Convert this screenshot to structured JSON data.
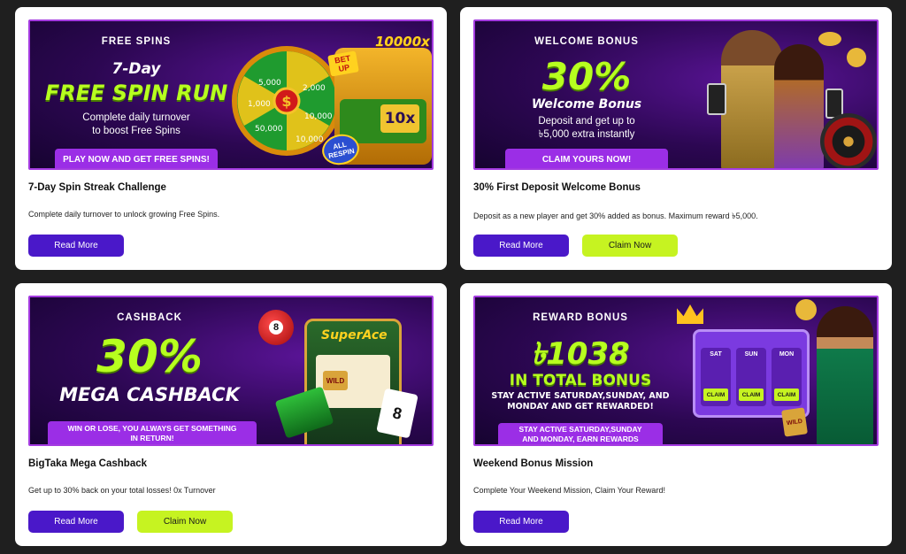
{
  "cards": [
    {
      "banner": {
        "kicker": "FREE SPINS",
        "line1": "7-Day",
        "headline": "FREE SPIN RUN",
        "sub1": "Complete daily turnover",
        "sub2": "to boost Free Spins",
        "cta": "PLAY NOW AND GET FREE SPINS!",
        "wheel_labels": [
          "5,000",
          "1,000",
          "50,000",
          "10,000",
          "2,000",
          "10,000"
        ],
        "multiplier": "10000x",
        "bet_up": "BET UP",
        "ten_x": "10x",
        "all_respin": "ALL RESPIN"
      },
      "title": "7-Day Spin Streak Challenge",
      "description": "Complete daily turnover to unlock growing Free Spins.",
      "read_more": "Read More"
    },
    {
      "banner": {
        "kicker": "WELCOME BONUS",
        "headline": "30%",
        "line2": "Welcome Bonus",
        "sub1": "Deposit and get up to",
        "sub2": "৳5,000 extra instantly",
        "cta": "CLAIM YOURS NOW!"
      },
      "title": "30% First Deposit Welcome Bonus",
      "description": "Deposit as a new player and get 30% added as bonus. Maximum reward ৳5,000.",
      "read_more": "Read More",
      "claim_now": "Claim Now"
    },
    {
      "banner": {
        "kicker": "CASHBACK",
        "headline": "30%",
        "line2": "MEGA CASHBACK",
        "cta1": "WIN OR LOSE, YOU ALWAYS GET SOMETHING",
        "cta2": "IN RETURN!",
        "superace": "SuperAce",
        "ball": "8",
        "card": "8",
        "wild": "WILD"
      },
      "title": "BigTaka Mega Cashback",
      "description": "Get up to 30% back on your total losses! 0x Turnover",
      "read_more": "Read More",
      "claim_now": "Claim Now"
    },
    {
      "banner": {
        "kicker": "REWARD BONUS",
        "headline": "৳1038",
        "line2": "IN TOTAL BONUS",
        "sub1": "STAY ACTIVE SATURDAY,SUNDAY, AND",
        "sub2": "MONDAY AND GET REWARDED!",
        "cta1": "STAY ACTIVE SATURDAY,SUNDAY",
        "cta2": "AND MONDAY, EARN REWARDS",
        "days": [
          "SAT",
          "SUN",
          "MON"
        ],
        "claim": "CLAIM",
        "wild": "WILD"
      },
      "title": "Weekend Bonus Mission",
      "description": "Complete Your Weekend Mission, Claim Your Reward!",
      "read_more": "Read More"
    }
  ],
  "colors": {
    "page_bg": "#1f1f1f",
    "card_bg": "#ffffff",
    "read_more_bg": "#4a18c9",
    "claim_bg": "#c6f321",
    "banner_border": "#a43be0",
    "accent_green": "#b7ff1f"
  }
}
